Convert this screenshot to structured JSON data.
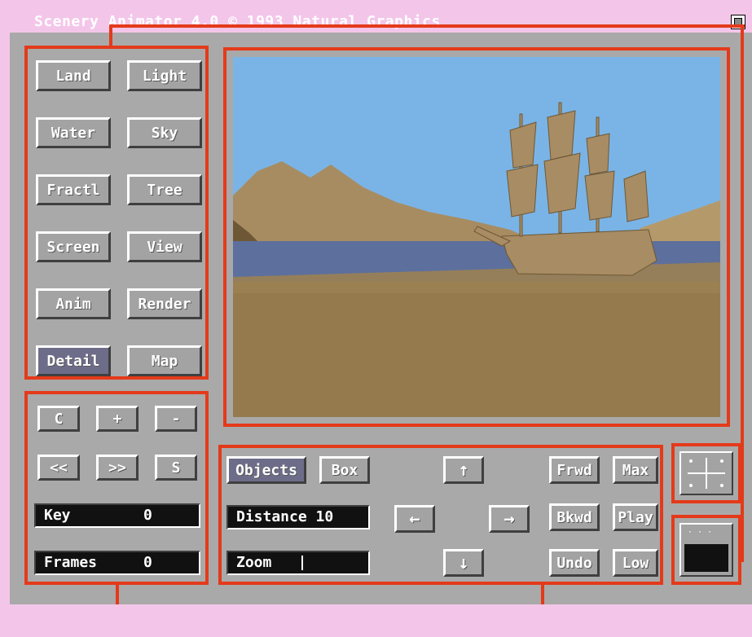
{
  "window": {
    "title": "Scenery Animator 4.0  © 1993 Natural Graphics"
  },
  "menu": {
    "land": "Land",
    "light": "Light",
    "water": "Water",
    "sky": "Sky",
    "fractal": "Fractl",
    "tree": "Tree",
    "screen": "Screen",
    "view": "View",
    "anim": "Anim",
    "render": "Render",
    "detail": "Detail",
    "map": "Map"
  },
  "keyframe": {
    "clear": "C",
    "add": "+",
    "remove": "-",
    "prev": "<<",
    "next": ">>",
    "set": "S",
    "key_label": "Key",
    "key_value": "0",
    "frames_label": "Frames",
    "frames_value": "0"
  },
  "camera": {
    "objects": "Objects",
    "box": "Box",
    "distance_label": "Distance 10",
    "zoom_label": "Zoom",
    "up": "↑",
    "left": "←",
    "right": "→",
    "down": "↓",
    "frwd": "Frwd",
    "bkwd": "Bkwd",
    "undo": "Undo",
    "max": "Max",
    "play": "Play",
    "low": "Low"
  },
  "icons": {
    "compass": "compass-icon",
    "depth": "window-depth-icon"
  },
  "colors": {
    "background": "#f3c6e9",
    "panel": "#a9a9a9",
    "callout": "#e43a1a",
    "sky": "#7ab4e6",
    "water": "#5d6f9c",
    "ground": "#947a4c"
  }
}
